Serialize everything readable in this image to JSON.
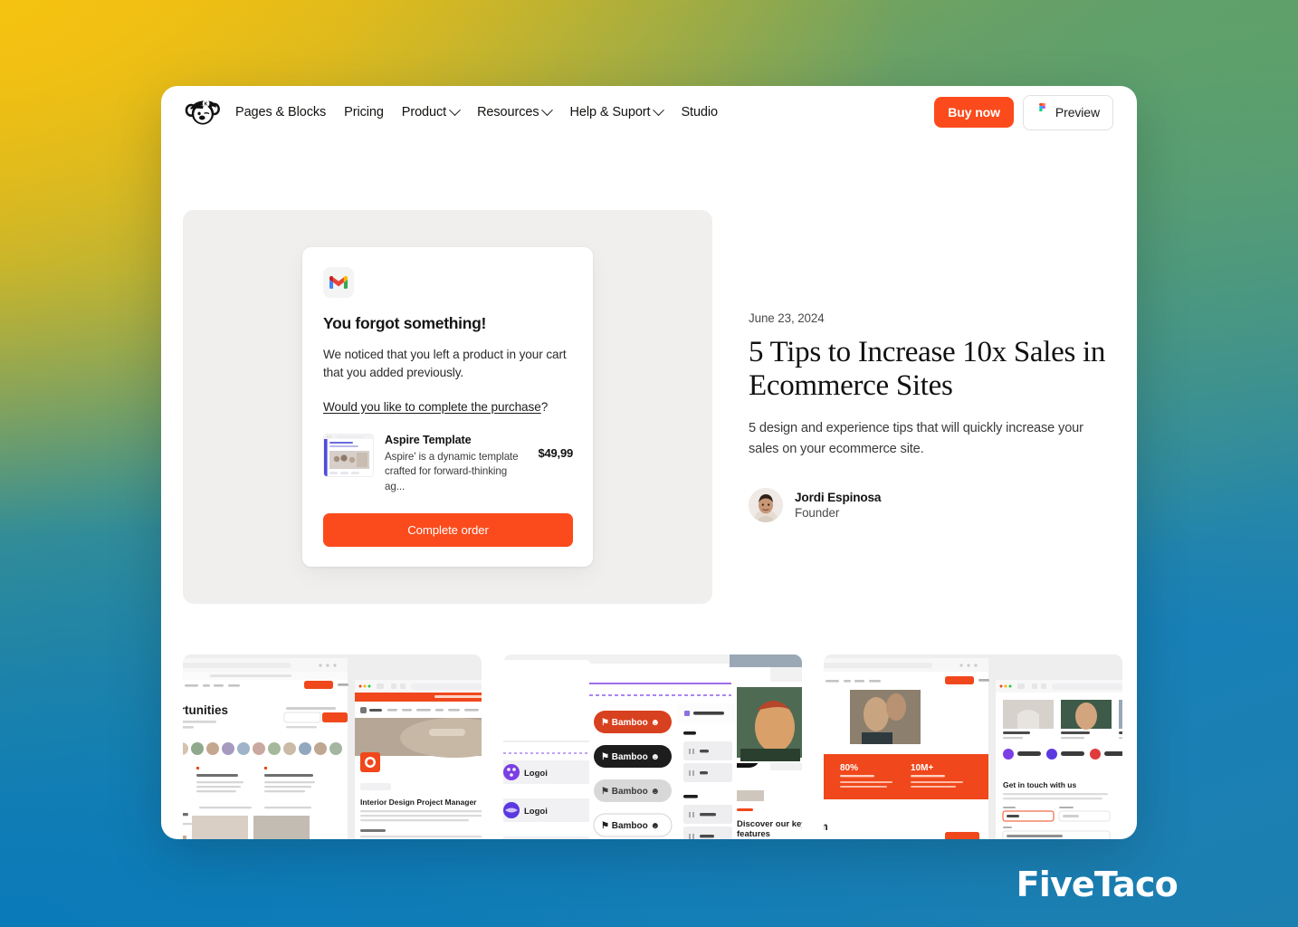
{
  "background": {
    "gradient_colors": [
      "#e8b60e",
      "#5fa06a",
      "#0a7ab8",
      "#1d7fb0"
    ],
    "watermark": "FiveTaco"
  },
  "header": {
    "logo_icon": "koala-mascot-logo",
    "nav": [
      {
        "label": "Pages & Blocks",
        "has_caret": false
      },
      {
        "label": "Pricing",
        "has_caret": false
      },
      {
        "label": "Product",
        "has_caret": true
      },
      {
        "label": "Resources",
        "has_caret": true
      },
      {
        "label": "Help & Suport",
        "has_caret": true
      },
      {
        "label": "Studio",
        "has_caret": false
      }
    ],
    "buy_label": "Buy now",
    "preview_label": "Preview",
    "preview_icon": "figma-icon",
    "accent_color": "#fb4b1c"
  },
  "email_card": {
    "provider_icon": "gmail-icon",
    "title": "You forgot something!",
    "body": "We noticed that you left a product in your cart that you added previously.",
    "link_text": "Would you like to complete the purchase",
    "link_suffix": "?",
    "product": {
      "name": "Aspire Template",
      "description": "Aspire' is a dynamic template crafted for forward-thinking ag...",
      "price": "$49,99",
      "thumbnail_icon": "template-preview-thumbnail"
    },
    "cta_label": "Complete order",
    "cta_color": "#fb4b1c"
  },
  "article": {
    "date": "June 23, 2024",
    "title": "5 Tips to Increase 10x Sales in Ecommerce Sites",
    "excerpt": "5 design and experience tips that will quickly increase your sales on your ecommerce site.",
    "author": {
      "avatar_icon": "author-avatar",
      "name": "Jordi Espinosa",
      "role": "Founder"
    }
  },
  "gallery": {
    "cards": [
      {
        "name": "careers-and-job-listing-template-preview"
      },
      {
        "name": "logos-buttons-and-components-template-preview"
      },
      {
        "name": "about-team-and-contact-template-preview"
      }
    ]
  }
}
